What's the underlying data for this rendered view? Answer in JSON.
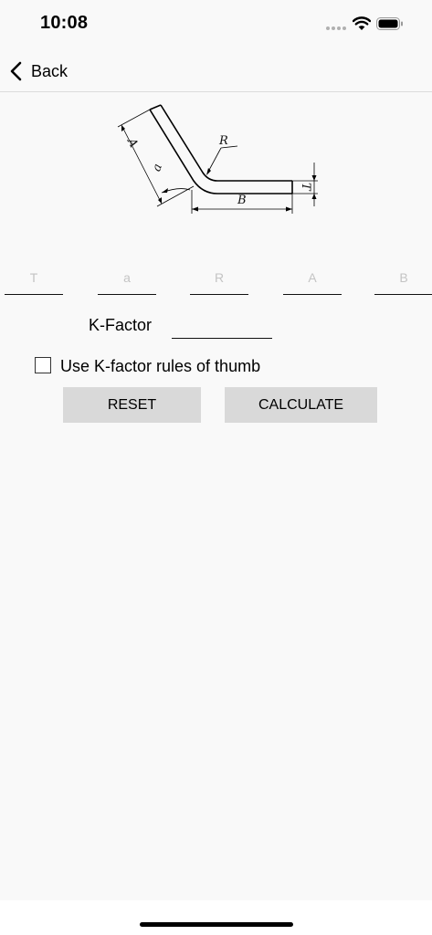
{
  "status_bar": {
    "time": "10:08",
    "signal_icon": "signal-dots-icon",
    "wifi_icon": "wifi-icon",
    "battery_icon": "battery-icon"
  },
  "nav": {
    "back_label": "Back",
    "back_icon": "chevron-left-icon"
  },
  "diagram": {
    "labels": {
      "A": "A",
      "a": "a",
      "R": "R",
      "B": "B",
      "T": "T"
    }
  },
  "params": {
    "T": {
      "placeholder": "T",
      "value": ""
    },
    "a": {
      "placeholder": "a",
      "value": ""
    },
    "R": {
      "placeholder": "R",
      "value": ""
    },
    "A": {
      "placeholder": "A",
      "value": ""
    },
    "B": {
      "placeholder": "B",
      "value": ""
    }
  },
  "kfactor": {
    "label": "K-Factor",
    "value": ""
  },
  "rule_of_thumb": {
    "label": "Use K-factor rules of thumb",
    "checked": false
  },
  "buttons": {
    "reset": "RESET",
    "calculate": "CALCULATE"
  },
  "colors": {
    "background": "#f9f9f9",
    "button_bg": "#d9d9d9",
    "placeholder": "#c4c4c4"
  }
}
